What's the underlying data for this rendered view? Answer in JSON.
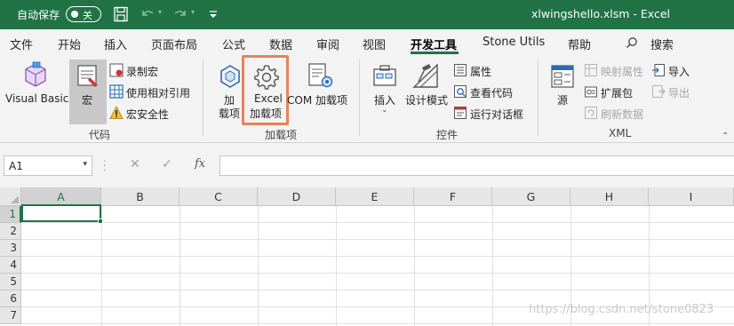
{
  "titlebar": {
    "autosave_label": "自动保存",
    "autosave_state": "关",
    "doc_title": "xlwingshello.xlsm  -  Excel"
  },
  "tabs": [
    "文件",
    "开始",
    "插入",
    "页面布局",
    "公式",
    "数据",
    "审阅",
    "视图",
    "开发工具",
    "Stone Utils",
    "帮助",
    "搜索"
  ],
  "active_tab": "开发工具",
  "ribbon": {
    "code": {
      "visual_basic": "Visual Basic",
      "macros": "宏",
      "record_macro": "录制宏",
      "relative_refs": "使用相对引用",
      "macro_security": "宏安全性",
      "group_label": "代码"
    },
    "addins": {
      "addins_line1": "加",
      "addins_line2": "载项",
      "excel_addins_line1": "Excel",
      "excel_addins_line2": "加载项",
      "com_addins": "COM 加载项",
      "group_label": "加载项"
    },
    "controls": {
      "insert": "插入",
      "design_mode": "设计模式",
      "properties": "属性",
      "view_code": "查看代码",
      "run_dialog": "运行对话框",
      "group_label": "控件"
    },
    "xml": {
      "source": "源",
      "map_properties": "映射属性",
      "expansion_packs": "扩展包",
      "refresh_data": "刷新数据",
      "import": "导入",
      "export": "导出",
      "group_label": "XML"
    }
  },
  "formula_bar": {
    "name_box": "A1",
    "formula": ""
  },
  "grid": {
    "columns": [
      "A",
      "B",
      "C",
      "D",
      "E",
      "F",
      "G",
      "H",
      "I"
    ],
    "rows": [
      "1",
      "2",
      "3",
      "4",
      "5",
      "6",
      "7"
    ],
    "active_cell": "A1"
  },
  "watermark": "https://blog.csdn.net/stone0823",
  "colors": {
    "excel_green": "#217346",
    "highlight": "#e8825a"
  }
}
